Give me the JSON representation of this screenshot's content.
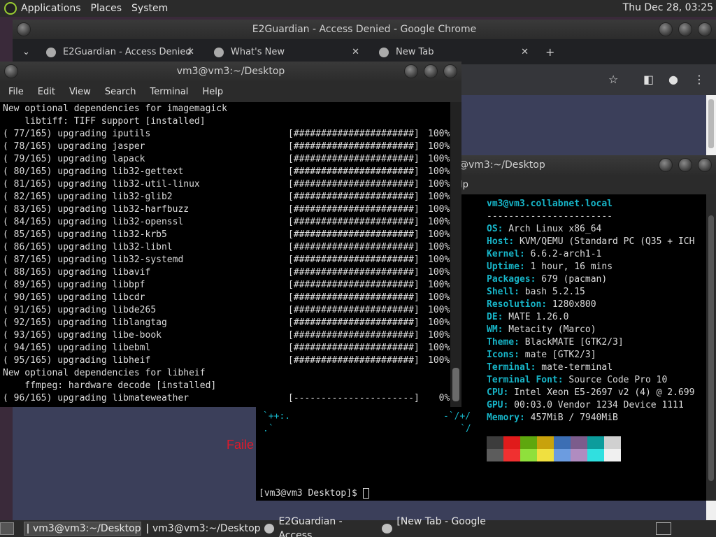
{
  "top_panel": {
    "menus": [
      "Applications",
      "Places",
      "System"
    ],
    "clock": "Thu Dec 28, 03:25"
  },
  "chrome": {
    "title": "E2Guardian - Access Denied - Google Chrome",
    "tabs": [
      {
        "label": "E2Guardian - Access Denied"
      },
      {
        "label": "What's New"
      },
      {
        "label": "New Tab"
      }
    ],
    "new_tab_symbol": "+",
    "tab_list_symbol": "⌄",
    "content_partial_text": "Faile"
  },
  "term_back": {
    "title": "@vm3:~/Desktop",
    "help_menu": "lp",
    "neofetch": {
      "user_host": "vm3@vm3.collabnet.local",
      "separator": "-----------------------",
      "rows": [
        {
          "key": "OS",
          "value": " Arch Linux x86_64"
        },
        {
          "key": "Host",
          "value": " KVM/QEMU (Standard PC (Q35 + ICH"
        },
        {
          "key": "Kernel",
          "value": " 6.6.2-arch1-1"
        },
        {
          "key": "Uptime",
          "value": " 1 hour, 16 mins"
        },
        {
          "key": "Packages",
          "value": " 679 (pacman)"
        },
        {
          "key": "Shell",
          "value": " bash 5.2.15"
        },
        {
          "key": "Resolution",
          "value": " 1280x800"
        },
        {
          "key": "DE",
          "value": " MATE 1.26.0"
        },
        {
          "key": "WM",
          "value": " Metacity (Marco)"
        },
        {
          "key": "Theme",
          "value": " BlackMATE [GTK2/3]"
        },
        {
          "key": "Icons",
          "value": " mate [GTK2/3]"
        },
        {
          "key": "Terminal",
          "value": " mate-terminal"
        },
        {
          "key": "Terminal Font",
          "value": " Source Code Pro 10"
        },
        {
          "key": "CPU",
          "value": " Intel Xeon E5-2697 v2 (4) @ 2.699"
        },
        {
          "key": "GPU",
          "value": " 00:03.0 Vendor 1234 Device 1111"
        },
        {
          "key": "Memory",
          "value": " 457MiB / 7940MiB"
        }
      ],
      "ascii_lines": [
        "`++:.",
        ".`",
        "-`/+/",
        "`/"
      ],
      "swatch_colors_top": [
        "#3c3c3c",
        "#e01b1b",
        "#5ea70e",
        "#c8a20c",
        "#3c6eb4",
        "#7c5c8c",
        "#0c9c9c",
        "#d0d0d0"
      ],
      "swatch_colors_bottom": [
        "#5c5c5c",
        "#f03030",
        "#8fe03c",
        "#f0e040",
        "#6c9ce0",
        "#b08cc0",
        "#30e0e0",
        "#f0f0f0"
      ]
    },
    "prompt": "[vm3@vm3 Desktop]$ "
  },
  "term_front": {
    "title": "vm3@vm3:~/Desktop",
    "menu": [
      "File",
      "Edit",
      "View",
      "Search",
      "Terminal",
      "Help"
    ],
    "lines": [
      {
        "text": "New optional dependencies for imagemagick",
        "bar": "",
        "pct": ""
      },
      {
        "text": "    libtiff: TIFF support [installed]",
        "bar": "",
        "pct": ""
      },
      {
        "text": "( 77/165) upgrading iputils",
        "bar": "[######################]",
        "pct": "100%"
      },
      {
        "text": "( 78/165) upgrading jasper",
        "bar": "[######################]",
        "pct": "100%"
      },
      {
        "text": "( 79/165) upgrading lapack",
        "bar": "[######################]",
        "pct": "100%"
      },
      {
        "text": "( 80/165) upgrading lib32-gettext",
        "bar": "[######################]",
        "pct": "100%"
      },
      {
        "text": "( 81/165) upgrading lib32-util-linux",
        "bar": "[######################]",
        "pct": "100%"
      },
      {
        "text": "( 82/165) upgrading lib32-glib2",
        "bar": "[######################]",
        "pct": "100%"
      },
      {
        "text": "( 83/165) upgrading lib32-harfbuzz",
        "bar": "[######################]",
        "pct": "100%"
      },
      {
        "text": "( 84/165) upgrading lib32-openssl",
        "bar": "[######################]",
        "pct": "100%"
      },
      {
        "text": "( 85/165) upgrading lib32-krb5",
        "bar": "[######################]",
        "pct": "100%"
      },
      {
        "text": "( 86/165) upgrading lib32-libnl",
        "bar": "[######################]",
        "pct": "100%"
      },
      {
        "text": "( 87/165) upgrading lib32-systemd",
        "bar": "[######################]",
        "pct": "100%"
      },
      {
        "text": "( 88/165) upgrading libavif",
        "bar": "[######################]",
        "pct": "100%"
      },
      {
        "text": "( 89/165) upgrading libbpf",
        "bar": "[######################]",
        "pct": "100%"
      },
      {
        "text": "( 90/165) upgrading libcdr",
        "bar": "[######################]",
        "pct": "100%"
      },
      {
        "text": "( 91/165) upgrading libde265",
        "bar": "[######################]",
        "pct": "100%"
      },
      {
        "text": "( 92/165) upgrading liblangtag",
        "bar": "[######################]",
        "pct": "100%"
      },
      {
        "text": "( 93/165) upgrading libe-book",
        "bar": "[######################]",
        "pct": "100%"
      },
      {
        "text": "( 94/165) upgrading libebml",
        "bar": "[######################]",
        "pct": "100%"
      },
      {
        "text": "( 95/165) upgrading libheif",
        "bar": "[######################]",
        "pct": "100%"
      },
      {
        "text": "New optional dependencies for libheif",
        "bar": "",
        "pct": ""
      },
      {
        "text": "    ffmpeg: hardware decode [installed]",
        "bar": "",
        "pct": ""
      },
      {
        "text": "( 96/165) upgrading libmateweather",
        "bar": "[----------------------]",
        "pct": "  0%"
      }
    ]
  },
  "bottom_panel": {
    "tasks": [
      {
        "label": "vm3@vm3:~/Desktop",
        "icon": "terminal-icon",
        "active": true
      },
      {
        "label": "vm3@vm3:~/Desktop",
        "icon": "terminal-icon",
        "active": false
      },
      {
        "label": "E2Guardian - Access...",
        "icon": "chrome-icon",
        "active": false
      },
      {
        "label": "[New Tab - Google ...",
        "icon": "chrome-icon",
        "active": false
      }
    ]
  }
}
